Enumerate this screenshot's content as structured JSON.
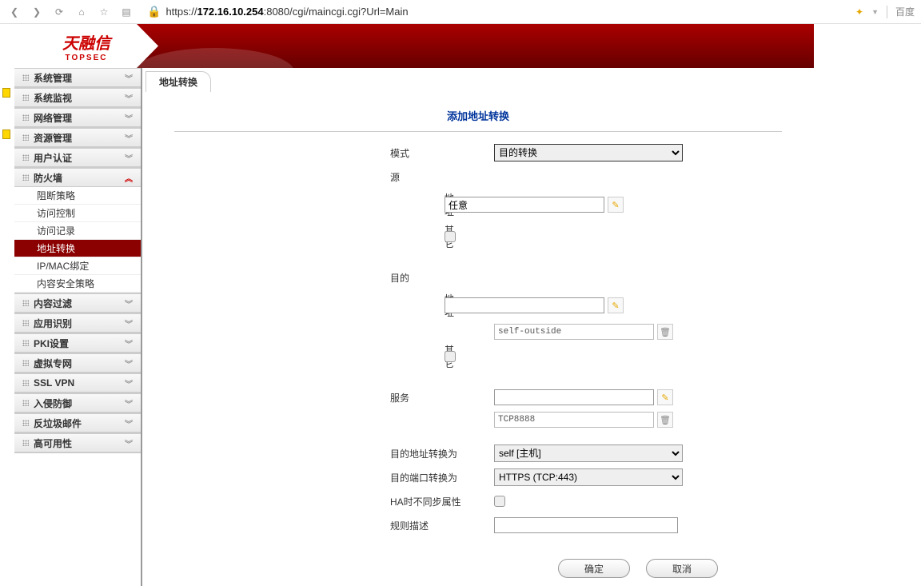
{
  "browser": {
    "url_prefix": "https://",
    "url_host": "172.16.10.254",
    "url_rest": ":8080/cgi/maincgi.cgi?Url=Main",
    "search_hint": "百度"
  },
  "logo": {
    "cn": "天融信",
    "en": "TOPSEC"
  },
  "sidebar": {
    "groups": [
      {
        "label": "系统管理",
        "expanded": false
      },
      {
        "label": "系统监视",
        "expanded": false
      },
      {
        "label": "网络管理",
        "expanded": false
      },
      {
        "label": "资源管理",
        "expanded": false
      },
      {
        "label": "用户认证",
        "expanded": false
      },
      {
        "label": "防火墙",
        "expanded": true,
        "items": [
          {
            "label": "阻断策略",
            "active": false
          },
          {
            "label": "访问控制",
            "active": false
          },
          {
            "label": "访问记录",
            "active": false
          },
          {
            "label": "地址转换",
            "active": true
          },
          {
            "label": "IP/MAC绑定",
            "active": false
          },
          {
            "label": "内容安全策略",
            "active": false
          }
        ]
      },
      {
        "label": "内容过滤",
        "expanded": false
      },
      {
        "label": "应用识别",
        "expanded": false
      },
      {
        "label": "PKI设置",
        "expanded": false
      },
      {
        "label": "虚拟专网",
        "expanded": false
      },
      {
        "label": "SSL VPN",
        "expanded": false
      },
      {
        "label": "入侵防御",
        "expanded": false
      },
      {
        "label": "反垃圾邮件",
        "expanded": false
      },
      {
        "label": "高可用性",
        "expanded": false
      }
    ]
  },
  "content": {
    "breadcrumb": "地址转换",
    "title": "添加地址转换",
    "labels": {
      "mode": "模式",
      "source": "源",
      "address": "地址",
      "other": "其它",
      "dest": "目的",
      "service": "服务",
      "dest_addr_to": "目的地址转换为",
      "dest_port_to": "目的端口转换为",
      "ha_sync": "HA时不同步属性",
      "rule_desc": "规则描述"
    },
    "values": {
      "mode_selected": "目的转换",
      "source_addr": "任意",
      "dest_addr": "",
      "dest_addr_value": "self-outside",
      "service_value": "TCP8888",
      "dest_addr_to_sel": "self [主机]",
      "dest_port_to_sel": "HTTPS (TCP:443)",
      "rule_desc_val": ""
    },
    "buttons": {
      "ok": "确定",
      "cancel": "取消"
    }
  }
}
